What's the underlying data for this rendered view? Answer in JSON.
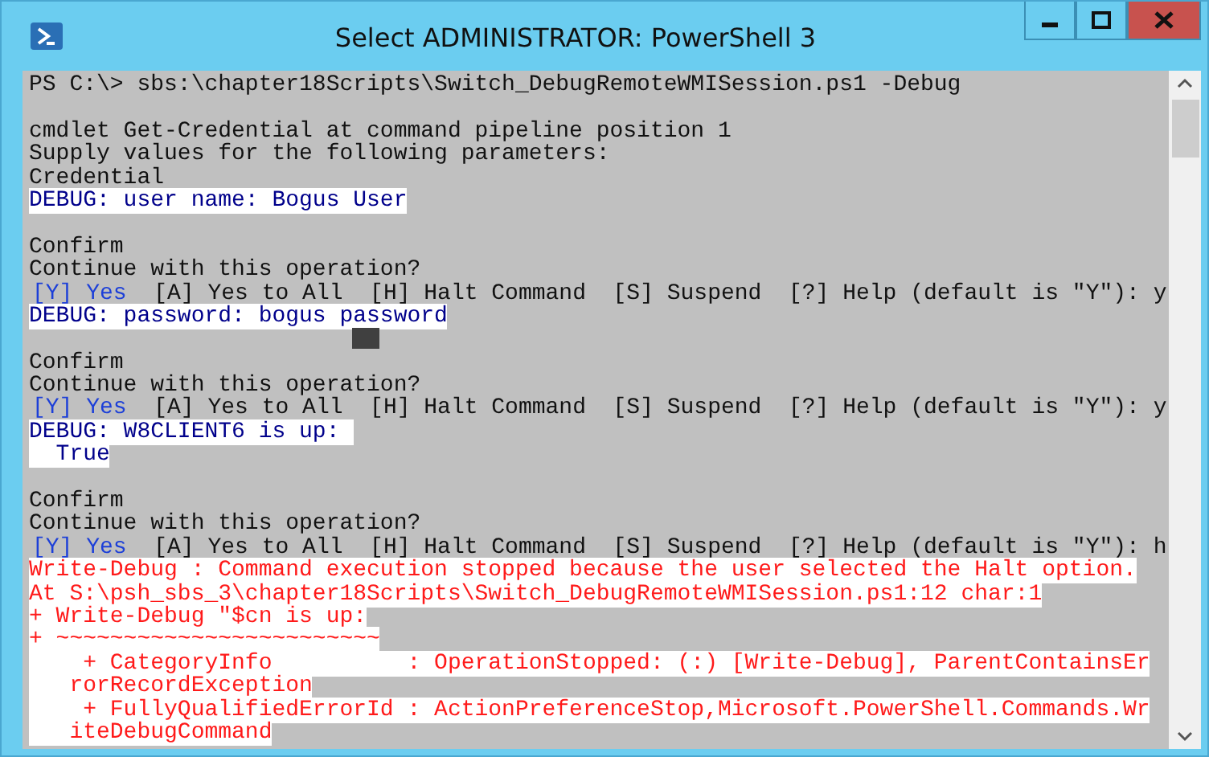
{
  "window": {
    "title": "Select ADMINISTRATOR: PowerShell 3"
  },
  "console": {
    "lines": [
      {
        "kind": "normal",
        "text": "PS C:\\> sbs:\\chapter18Scripts\\Switch_DebugRemoteWMISession.ps1 -Debug"
      },
      {
        "kind": "blank"
      },
      {
        "kind": "normal",
        "text": "cmdlet Get-Credential at command pipeline position 1"
      },
      {
        "kind": "normal",
        "text": "Supply values for the following parameters:"
      },
      {
        "kind": "normal",
        "text": "Credential"
      },
      {
        "kind": "debug",
        "text": "DEBUG: user name: Bogus User"
      },
      {
        "kind": "blank"
      },
      {
        "kind": "normal",
        "text": "Confirm"
      },
      {
        "kind": "normal",
        "text": "Continue with this operation?"
      },
      {
        "kind": "choice",
        "option": "[Y] Yes",
        "text": "[A] Yes to All  [H] Halt Command  [S] Suspend  [?] Help (default is \"Y\"): y"
      },
      {
        "kind": "debug",
        "text": "DEBUG: password: bogus password"
      },
      {
        "kind": "cursor"
      },
      {
        "kind": "normal",
        "text": "Confirm"
      },
      {
        "kind": "normal",
        "text": "Continue with this operation?"
      },
      {
        "kind": "choice",
        "option": "[Y] Yes",
        "text": "[A] Yes to All  [H] Halt Command  [S] Suspend  [?] Help (default is \"Y\"): y"
      },
      {
        "kind": "debug",
        "text": "DEBUG: W8CLIENT6 is up: "
      },
      {
        "kind": "debug",
        "text": "  True"
      },
      {
        "kind": "blank"
      },
      {
        "kind": "normal",
        "text": "Confirm"
      },
      {
        "kind": "normal",
        "text": "Continue with this operation?"
      },
      {
        "kind": "choice",
        "option": "[Y] Yes",
        "text": "[A] Yes to All  [H] Halt Command  [S] Suspend  [?] Help (default is \"Y\"): h"
      },
      {
        "kind": "error",
        "text": "Write-Debug : Command execution stopped because the user selected the Halt option."
      },
      {
        "kind": "error",
        "text": "At S:\\psh_sbs_3\\chapter18Scripts\\Switch_DebugRemoteWMISession.ps1:12 char:1"
      },
      {
        "kind": "error",
        "text": "+ Write-Debug \"$cn is up:"
      },
      {
        "kind": "error",
        "text": "+ ~~~~~~~~~~~~~~~~~~~~~~~~"
      },
      {
        "kind": "error",
        "text": "    + CategoryInfo          : OperationStopped: (:) [Write-Debug], ParentContainsEr"
      },
      {
        "kind": "error",
        "text": "   rorRecordException"
      },
      {
        "kind": "error",
        "text": "    + FullyQualifiedErrorId : ActionPreferenceStop,Microsoft.PowerShell.Commands.Wr"
      },
      {
        "kind": "error",
        "text": "   iteDebugCommand"
      }
    ]
  }
}
